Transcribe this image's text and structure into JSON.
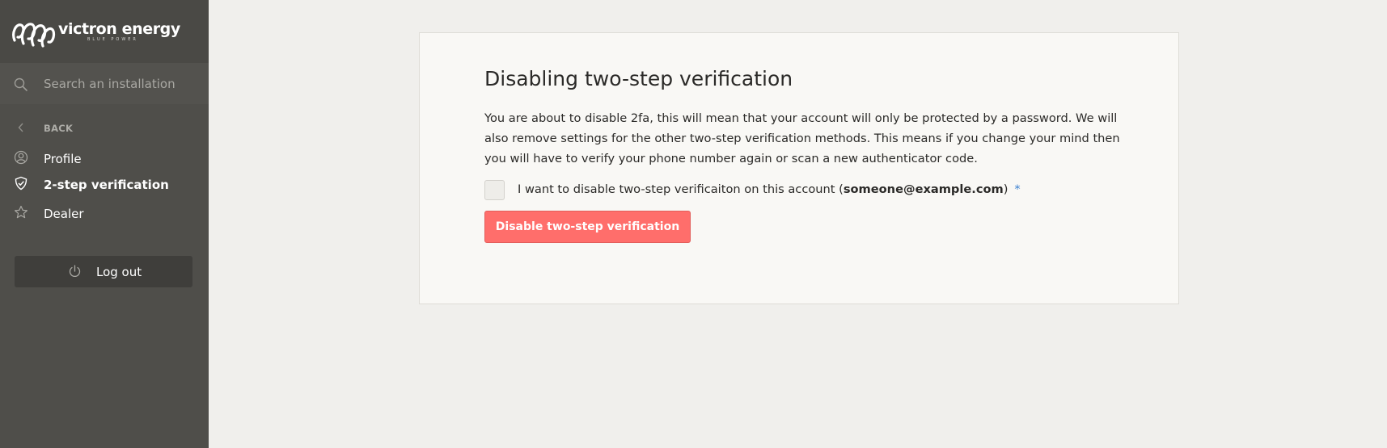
{
  "brand": {
    "name": "victron energy",
    "tagline": "BLUE POWER"
  },
  "search": {
    "placeholder": "Search an installation",
    "value": ""
  },
  "sidebar": {
    "back_label": "BACK",
    "items": [
      {
        "label": "Profile",
        "icon": "profile-icon",
        "active": false
      },
      {
        "label": "2-step verification",
        "icon": "shield-check-icon",
        "active": true
      },
      {
        "label": "Dealer",
        "icon": "star-icon",
        "active": false
      }
    ],
    "logout_label": "Log out"
  },
  "main": {
    "title": "Disabling two-step verification",
    "description": "You are about to disable 2fa, this will mean that your account will only be protected by a password. We will also remove settings for the other two-step verification methods. This means if you change your mind then you will have to verify your phone number again or scan a new authenticator code.",
    "confirm_prefix": "I want to disable two-step verificaiton on this account (",
    "confirm_email": "someone@example.com",
    "confirm_suffix": ")",
    "required_mark": "*",
    "confirm_checked": false,
    "button_label": "Disable two-step verification"
  },
  "colors": {
    "sidebar_bg": "#4f4e4a",
    "page_bg": "#f0efec",
    "card_bg": "#f9f8f5",
    "danger": "#ff6e6b",
    "required": "#3a7fd0"
  }
}
